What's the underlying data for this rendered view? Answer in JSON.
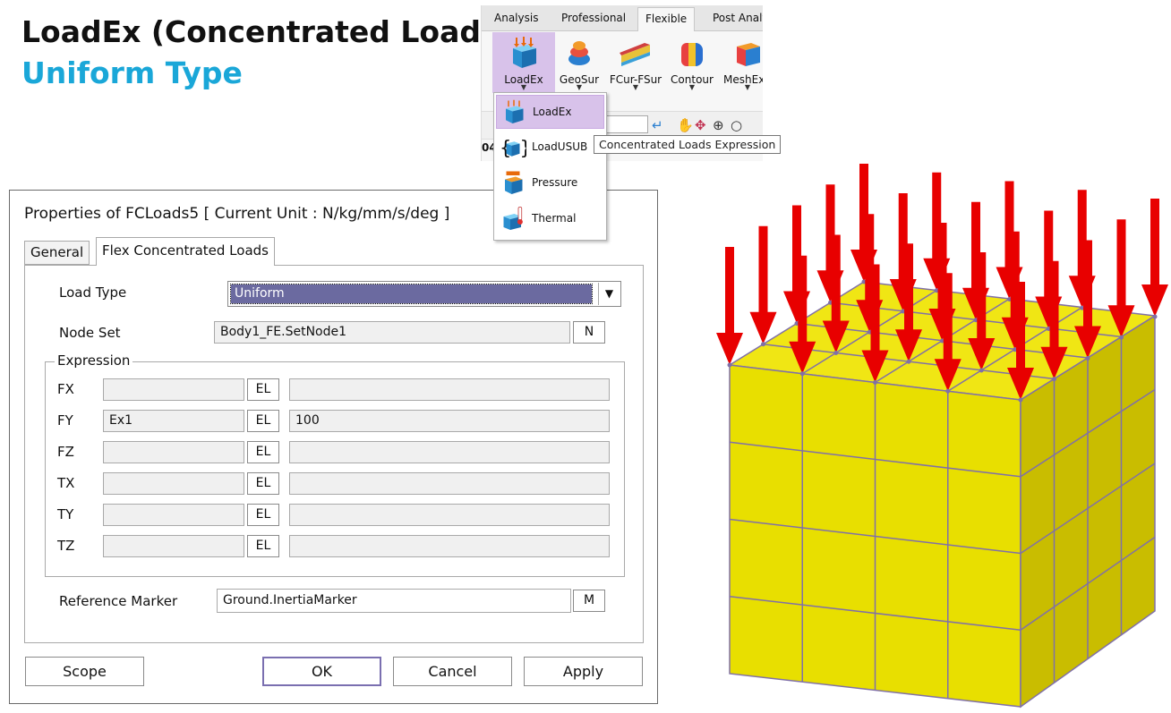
{
  "slide": {
    "title": "LoadEx (Concentrated Load)",
    "subtitle": "Uniform Type"
  },
  "dialog": {
    "title": "Properties of FCLoads5 [ Current Unit : N/kg/mm/s/deg ]",
    "tabs": [
      {
        "label": "General",
        "active": false
      },
      {
        "label": "Flex Concentrated Loads",
        "active": true
      }
    ],
    "load_type": {
      "label": "Load Type",
      "value": "Uniform"
    },
    "node_set": {
      "label": "Node Set",
      "value": "Body1_FE.SetNode1",
      "button": "N"
    },
    "expression": {
      "legend": "Expression",
      "el_label": "EL",
      "rows": [
        {
          "label": "FX",
          "name": "",
          "value": ""
        },
        {
          "label": "FY",
          "name": "Ex1",
          "value": "100"
        },
        {
          "label": "FZ",
          "name": "",
          "value": ""
        },
        {
          "label": "TX",
          "name": "",
          "value": ""
        },
        {
          "label": "TY",
          "name": "",
          "value": ""
        },
        {
          "label": "TZ",
          "name": "",
          "value": ""
        }
      ]
    },
    "reference_marker": {
      "label": "Reference Marker",
      "value": "Ground.InertiaMarker",
      "button": "M"
    },
    "buttons": {
      "scope": "Scope",
      "ok": "OK",
      "cancel": "Cancel",
      "apply": "Apply"
    }
  },
  "ribbon": {
    "tabs": [
      "Analysis",
      "Professional",
      "Flexible",
      "Post Analy"
    ],
    "active_tab": "Flexible",
    "buttons": [
      "LoadEx",
      "GeoSur",
      "FCur-FSur",
      "Contour",
      "MeshExp"
    ],
    "side_text": "04"
  },
  "dropdown": {
    "items": [
      "LoadEx",
      "LoadUSUB",
      "Pressure",
      "Thermal"
    ],
    "active": "LoadEx"
  },
  "tooltip": "Concentrated Loads Expression",
  "colors": {
    "accent": "#1aa7d8",
    "selection": "#6b6aa0",
    "menu_highlight": "#d8c2ea",
    "arrow": "#e80000",
    "cube_top": "#f0e614",
    "cube_front": "#e8df00",
    "cube_side": "#c9bd00",
    "mesh": "#8070a8"
  },
  "graphic": {
    "mesh_divisions": 4,
    "load_direction": "down",
    "arrow_count": 25
  }
}
